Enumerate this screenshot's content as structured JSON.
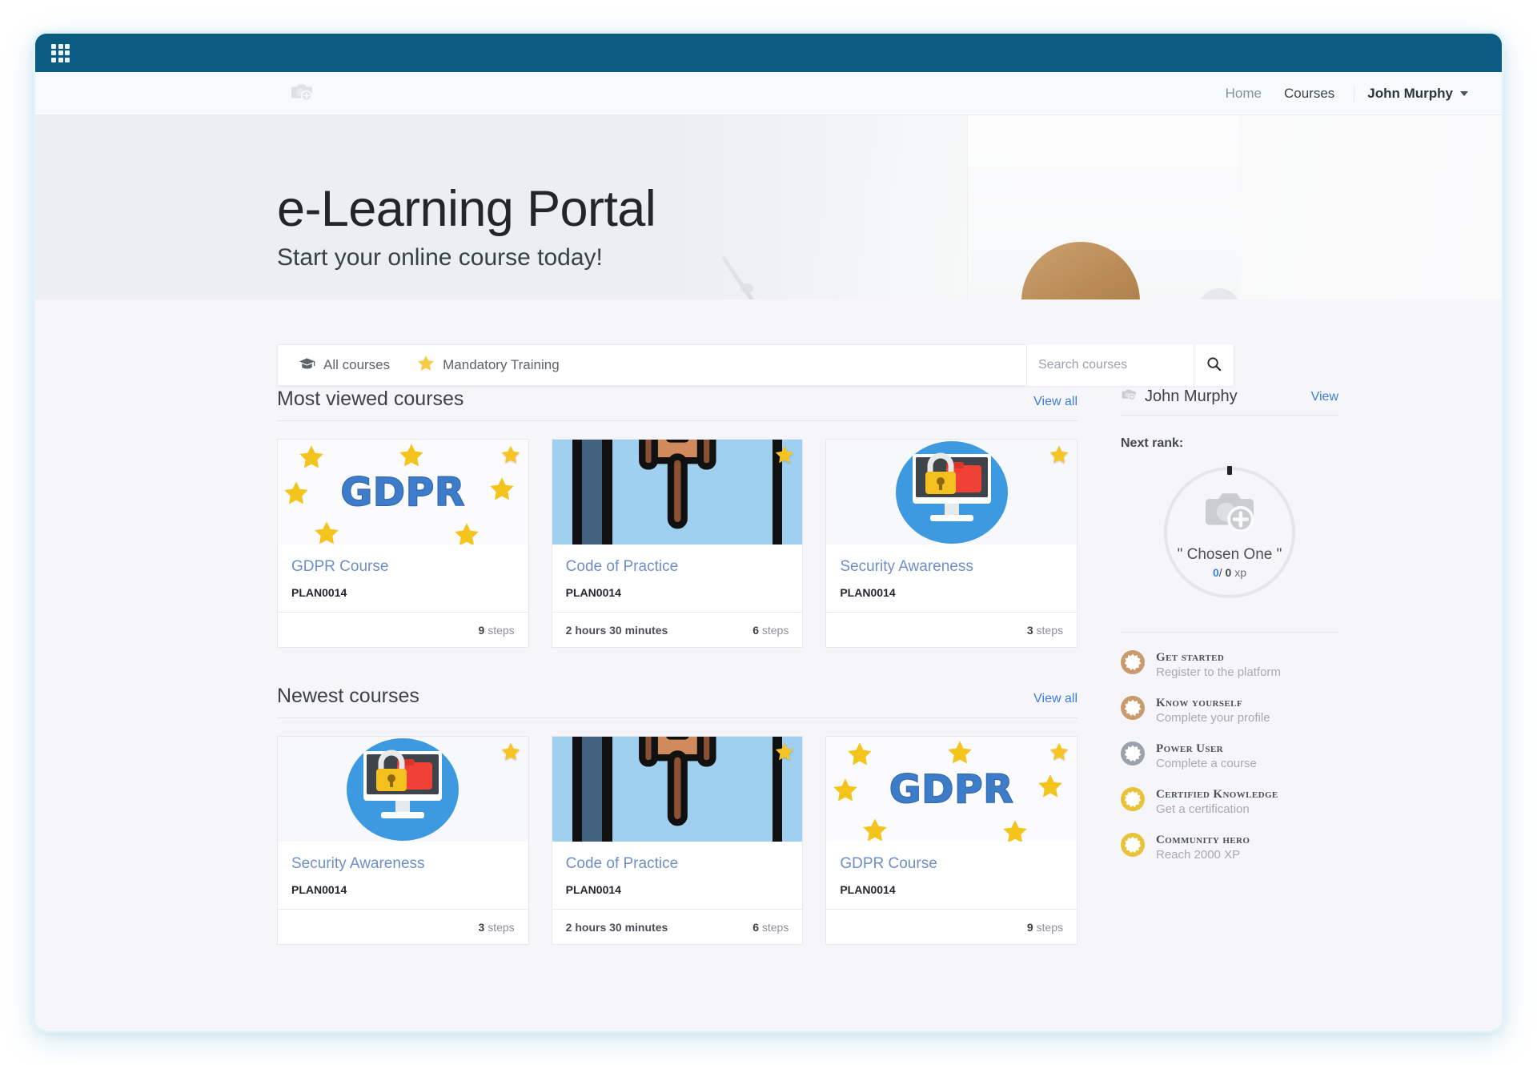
{
  "topbar": {
    "apps_icon": "grid-apps-icon"
  },
  "nav": {
    "logo_icon": "camera-plus-placeholder-icon",
    "links": [
      {
        "label": "Home",
        "active": false
      },
      {
        "label": "Courses",
        "active": true
      }
    ],
    "user": "John Murphy",
    "caret_icon": "chevron-down-icon"
  },
  "hero": {
    "title": "e-Learning Portal",
    "subtitle": "Start your online course today!"
  },
  "filterbar": {
    "items": [
      {
        "label": "All courses",
        "icon": "graduation-cap-icon"
      },
      {
        "label": "Mandatory Training",
        "icon": "star-icon"
      }
    ],
    "search_placeholder": "Search courses",
    "search_value": "",
    "search_icon": "search-icon"
  },
  "sections": [
    {
      "title": "Most viewed courses",
      "view_all": "View all",
      "cards": [
        {
          "thumb": "gdpr",
          "mandatory": true,
          "title": "GDPR Course",
          "code": "PLAN0014",
          "duration": "",
          "steps": "9",
          "steps_label": "steps"
        },
        {
          "thumb": "cop",
          "mandatory": true,
          "title": "Code of Practice",
          "code": "PLAN0014",
          "duration": "2 hours 30 minutes",
          "steps": "6",
          "steps_label": "steps"
        },
        {
          "thumb": "sec",
          "mandatory": true,
          "title": "Security Awareness",
          "code": "PLAN0014",
          "duration": "",
          "steps": "3",
          "steps_label": "steps"
        }
      ]
    },
    {
      "title": "Newest courses",
      "view_all": "View all",
      "cards": [
        {
          "thumb": "sec",
          "mandatory": true,
          "title": "Security Awareness",
          "code": "PLAN0014",
          "duration": "",
          "steps": "3",
          "steps_label": "steps"
        },
        {
          "thumb": "cop",
          "mandatory": true,
          "title": "Code of Practice",
          "code": "PLAN0014",
          "duration": "2 hours 30 minutes",
          "steps": "6",
          "steps_label": "steps"
        },
        {
          "thumb": "gdpr",
          "mandatory": true,
          "title": "GDPR Course",
          "code": "PLAN0014",
          "duration": "",
          "steps": "9",
          "steps_label": "steps"
        }
      ]
    }
  ],
  "sidebar": {
    "user": "John Murphy",
    "avatar_icon": "camera-plus-placeholder-icon",
    "view_label": "View",
    "next_rank_label": "Next rank:",
    "rank": {
      "name": "\" Chosen One \"",
      "xp_current": "0",
      "xp_separator": "/",
      "xp_total": "0",
      "xp_unit": "xp",
      "progress_percent": 0,
      "placeholder_icon": "camera-plus-placeholder-icon"
    },
    "badges": [
      {
        "title": "Get started",
        "desc": "Register to the platform",
        "color": "#c99a6b"
      },
      {
        "title": "Know yourself",
        "desc": "Complete your profile",
        "color": "#c99a6b"
      },
      {
        "title": "Power User",
        "desc": "Complete a course",
        "color": "#9aa3ab"
      },
      {
        "title": "Certified Knowledge",
        "desc": "Get a certification",
        "color": "#e8c33a"
      },
      {
        "title": "Community hero",
        "desc": "Reach 2000 XP",
        "color": "#e8c33a"
      }
    ]
  },
  "colors": {
    "topbar": "#0a5c82",
    "accent_link": "#3b7dd8",
    "card_title": "#6e8ec7",
    "page_bg": "#f5f5fa",
    "star": "#f5c518"
  }
}
